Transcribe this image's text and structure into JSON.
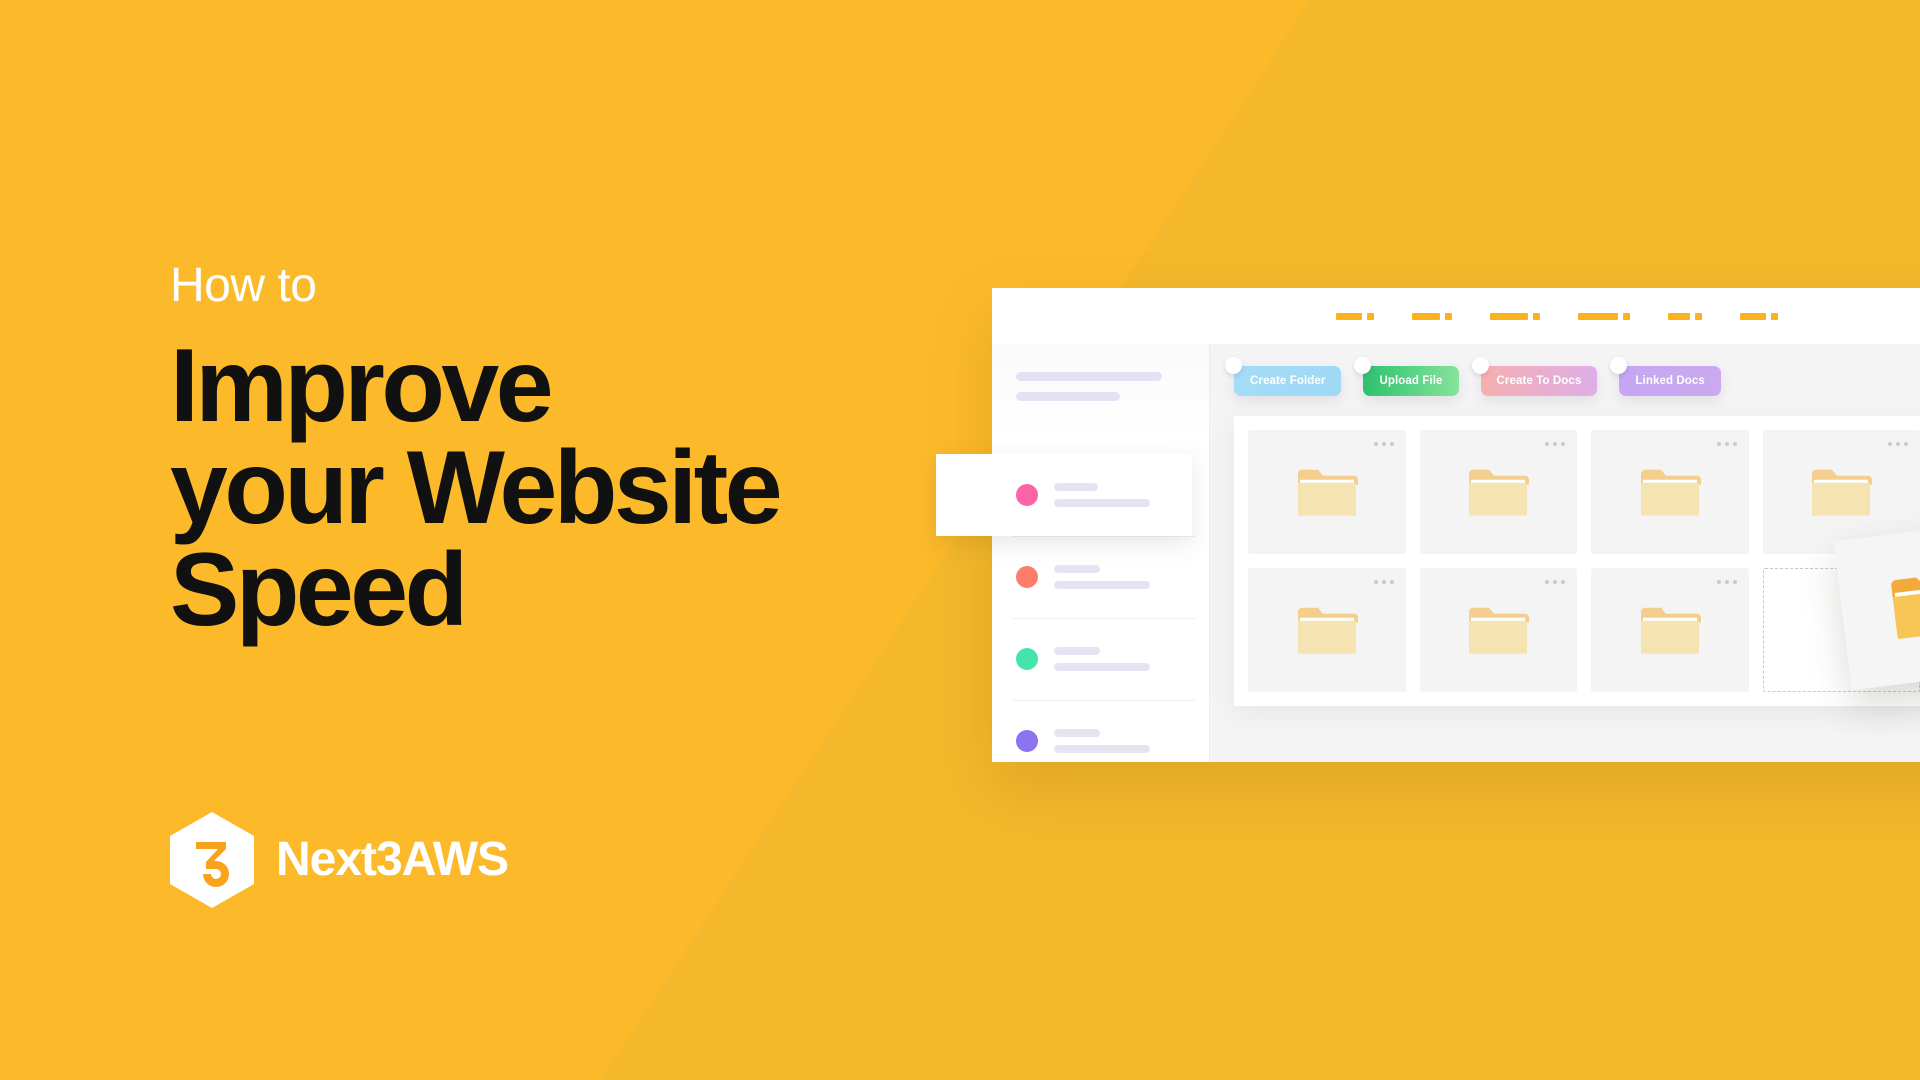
{
  "theme": {
    "background": "#FCBA2B",
    "background_accent": "#F5B82C",
    "headline_color": "#111111",
    "kicker_color": "#FFFFFF",
    "brand_orange": "#FBB21F"
  },
  "hero": {
    "kicker": "How to",
    "title_lines": [
      "Improve",
      "your Website",
      "Speed"
    ]
  },
  "brand": {
    "name": "Next3AWS",
    "mark_digit": "3",
    "mark_shape": "hexagon-logo-icon"
  },
  "dashboard": {
    "topbar": {
      "nav_placeholders": [
        {
          "name": "nav-placeholder-1"
        },
        {
          "name": "nav-placeholder-2"
        },
        {
          "name": "nav-placeholder-3"
        },
        {
          "name": "nav-placeholder-4"
        },
        {
          "name": "nav-placeholder-5"
        },
        {
          "name": "nav-placeholder-6"
        }
      ],
      "avatar": "user-avatar"
    },
    "sidebar": {
      "header_placeholder_lines": 2,
      "items": [
        {
          "dot_color": "#FB64A5",
          "active": true
        },
        {
          "dot_color": "#FD7D6A",
          "active": false
        },
        {
          "dot_color": "#45E4AA",
          "active": false
        },
        {
          "dot_color": "#8C74F0",
          "active": false
        }
      ]
    },
    "actions": [
      {
        "label": "Create Folder",
        "color_start": "#A5DCF7",
        "color_end": "#9ED9F6"
      },
      {
        "label": "Upload File",
        "color_start": "#2CC26E",
        "color_end": "#86E39B"
      },
      {
        "label": "Create To Docs",
        "color_start": "#F6AFAF",
        "color_end": "#DFAEE8"
      },
      {
        "label": "Linked Docs",
        "color_start": "#C4A6F2",
        "color_end": "#CBA9F0"
      }
    ],
    "folder_grid": {
      "columns": 4,
      "rows": 2,
      "folder_color": "#F6E3B2",
      "folder_tab_color": "#F3CE8D",
      "cells": [
        {
          "type": "folder"
        },
        {
          "type": "folder"
        },
        {
          "type": "folder"
        },
        {
          "type": "folder"
        },
        {
          "type": "folder"
        },
        {
          "type": "folder"
        },
        {
          "type": "folder"
        },
        {
          "type": "dropzone"
        }
      ]
    },
    "dragged_item": {
      "type": "folder",
      "folder_color": "#F7C556",
      "folder_tab_color": "#F3A93C",
      "state": "dragging"
    }
  }
}
